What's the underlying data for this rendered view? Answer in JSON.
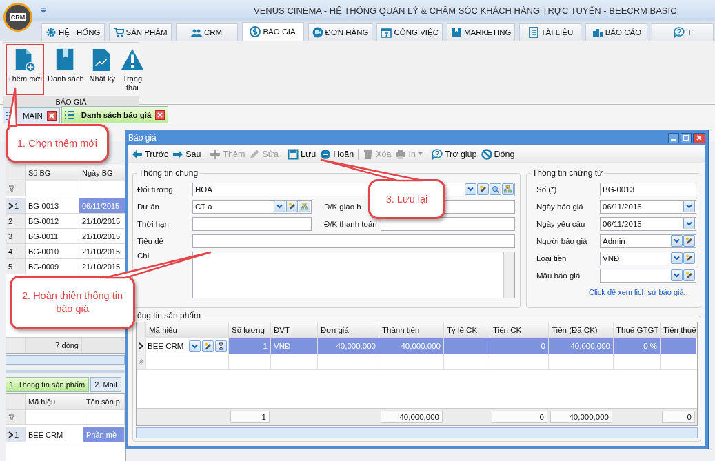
{
  "app": {
    "logo_text": "CRM",
    "title": "VENUS CINEMA - HỆ THỐNG QUẢN LÝ & CHĂM SÓC KHÁCH HÀNG TRỰC TUYẾN - BEECRM BASIC"
  },
  "ribbon_tabs": [
    {
      "label": "HỆ THỐNG",
      "selected": false
    },
    {
      "label": "SẢN PHẨM",
      "selected": false
    },
    {
      "label": "CRM",
      "selected": false
    },
    {
      "label": "BÁO GIÁ",
      "selected": true
    },
    {
      "label": "ĐƠN HÀNG",
      "selected": false
    },
    {
      "label": "CÔNG VIỆC",
      "selected": false
    },
    {
      "label": "MARKETING",
      "selected": false
    },
    {
      "label": "TÀI LIỆU",
      "selected": false
    },
    {
      "label": "BÁO CÁO",
      "selected": false
    },
    {
      "label": "T",
      "selected": false
    }
  ],
  "ribbon_group": {
    "label": "BÁO GIÁ",
    "buttons": [
      {
        "label": "Thêm mới",
        "highlighted": true
      },
      {
        "label": "Danh sách",
        "highlighted": false
      },
      {
        "label": "Nhật ký",
        "highlighted": false
      },
      {
        "label": "Trạng thái",
        "highlighted": false
      }
    ]
  },
  "doc_tabs": [
    {
      "label": "MAIN",
      "selected": false
    },
    {
      "label": "Danh sách báo giá",
      "selected": true
    }
  ],
  "quote_list": {
    "columns": [
      "Số BG",
      "Ngày BG"
    ],
    "rows": [
      {
        "number": "1",
        "selected": true,
        "cells": [
          {
            "text": "BG-0013",
            "focused": false
          },
          {
            "text": "06/11/2015",
            "focused": true
          }
        ]
      },
      {
        "number": "2",
        "selected": false,
        "cells": [
          {
            "text": "BG-0012",
            "focused": false
          },
          {
            "text": "21/10/2015",
            "focused": false
          }
        ]
      },
      {
        "number": "3",
        "selected": false,
        "cells": [
          {
            "text": "BG-0011",
            "focused": false
          },
          {
            "text": "21/10/2015",
            "focused": false
          }
        ]
      },
      {
        "number": "4",
        "selected": false,
        "cells": [
          {
            "text": "BG-0010",
            "focused": false
          },
          {
            "text": "21/10/2015",
            "focused": false
          }
        ]
      },
      {
        "number": "5",
        "selected": false,
        "cells": [
          {
            "text": "BG-0009",
            "focused": false
          },
          {
            "text": "21/10/2015",
            "focused": false
          }
        ]
      }
    ],
    "footer": "7 dòng"
  },
  "detail_tabs": [
    {
      "label": "1. Thông tin sản phẩm",
      "selected": true
    },
    {
      "label": "2. Mail",
      "selected": false
    }
  ],
  "detail_grid": {
    "columns": [
      "Mã hiệu",
      "Tên sản p"
    ],
    "rows": [
      {
        "number": "1",
        "selected": true,
        "cells": [
          {
            "text": "BEE CRM",
            "focused": false
          },
          {
            "text": "Phần mề",
            "focused": true
          }
        ]
      }
    ]
  },
  "dialog": {
    "title": "Báo giá",
    "toolbar_groups": [
      {
        "items": [
          {
            "label": "Trước",
            "kind": "button",
            "disabled": false
          },
          {
            "label": "Sau",
            "kind": "button",
            "disabled": false
          }
        ]
      },
      {
        "items": [
          {
            "label": "Thêm",
            "kind": "button",
            "disabled": true
          },
          {
            "label": "Sửa",
            "kind": "button",
            "disabled": true
          }
        ]
      },
      {
        "items": [
          {
            "label": "Lưu",
            "kind": "button",
            "disabled": false
          },
          {
            "label": "Hoãn",
            "kind": "button",
            "disabled": false
          }
        ]
      },
      {
        "items": [
          {
            "label": "Xóa",
            "kind": "button",
            "disabled": true
          },
          {
            "label": "In",
            "kind": "menu",
            "disabled": true
          }
        ]
      },
      {
        "items": [
          {
            "label": "Trợ giúp",
            "kind": "button",
            "disabled": false
          },
          {
            "label": "Đóng",
            "kind": "button",
            "disabled": false
          }
        ]
      }
    ],
    "general": {
      "legend": "Thông tin chung",
      "rows": [
        {
          "fields": [
            {
              "label": "Đối tượng",
              "value": "HOA",
              "kind": "lookup"
            }
          ]
        },
        {
          "fields": [
            {
              "label": "Dự án",
              "value": "CT a",
              "kind": "project"
            },
            {
              "label": "Đ/K giao h",
              "kind": "text"
            }
          ]
        },
        {
          "fields": [
            {
              "label": "Thời hạn",
              "kind": "text"
            },
            {
              "label": "Đ/K thanh toán",
              "kind": "text"
            }
          ]
        },
        {
          "fields": [
            {
              "label": "Tiêu đề",
              "kind": "text"
            }
          ]
        },
        {
          "fields": [
            {
              "label": "Chi",
              "kind": "memo"
            }
          ]
        }
      ]
    },
    "document": {
      "legend": "Thông tin chứng từ",
      "fields": [
        {
          "label": "Số (*)",
          "value": "BG-0013",
          "kind": "text"
        },
        {
          "label": "Ngày báo giá",
          "value": "06/11/2015",
          "kind": "date"
        },
        {
          "label": "Ngày yêu cầu",
          "value": "06/11/2015",
          "kind": "date"
        },
        {
          "label": "Người báo giá",
          "value": "Admin",
          "kind": "combo"
        },
        {
          "label": "Loại tiền",
          "value": "VNĐ",
          "kind": "combo"
        },
        {
          "label": "Mẫu báo giá",
          "kind": "combo"
        }
      ],
      "history_link": "Click để xem lịch sử báo giá.."
    },
    "products": {
      "legend": "ông tin sản phẩm",
      "columns": [
        "Mã hiệu",
        "Số lượng",
        "ĐVT",
        "Đơn giá",
        "Thành tiền",
        "Tỷ lệ CK",
        "Tiền CK",
        "Tiền (Đã CK)",
        "Thuế GTGT",
        "Tiền thuế"
      ],
      "rows": [
        {
          "selected": true,
          "cells": [
            "BEE CRM",
            "1",
            "VNĐ",
            "40,000,000",
            "40,000,000",
            null,
            "0",
            "40,000,000",
            "0 %",
            null
          ]
        }
      ],
      "totals": [
        "1",
        "40,000,000",
        "0",
        "40,000,000",
        "0"
      ]
    }
  },
  "callouts": [
    {
      "text": "1. Chọn thêm mới"
    },
    {
      "text": "2. Hoàn thiện thông tin báo giá"
    },
    {
      "text": "3. Lưu lại"
    }
  ]
}
